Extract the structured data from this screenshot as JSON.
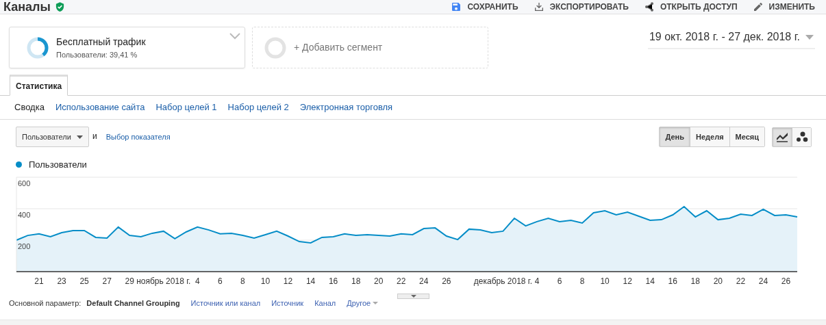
{
  "header": {
    "title": "Каналы",
    "actions": [
      {
        "label": "СОХРАНИТЬ"
      },
      {
        "label": "ЭКСПОРТИРОВАТЬ"
      },
      {
        "label": "ОТКРЫТЬ ДОСТУП"
      },
      {
        "label": "ИЗМЕНИТЬ"
      }
    ]
  },
  "segments": [
    {
      "kind": "segment",
      "name": "Бесплатный трафик",
      "subtitle": "Пользователи: 39,41 %"
    },
    {
      "kind": "add",
      "name": "+ Добавить сегмент"
    }
  ],
  "date_range": "19 окт. 2018 г. - 27 дек. 2018 г.",
  "tabs": [
    {
      "label": "Статистика",
      "selected": true
    }
  ],
  "subnav": [
    {
      "label": "Сводка",
      "selected": true
    },
    {
      "label": "Использование сайта",
      "selected": false
    },
    {
      "label": "Набор целей 1",
      "selected": false
    },
    {
      "label": "Набор целей 2",
      "selected": false
    },
    {
      "label": "Электронная торговля",
      "selected": false
    }
  ],
  "metric_select": {
    "value": "Пользователи"
  },
  "conjunction": "и",
  "metric_link": "Выбор показателя",
  "period_buttons": [
    {
      "label": "День",
      "selected": true
    },
    {
      "label": "Неделя",
      "selected": false
    },
    {
      "label": "Месяц",
      "selected": false
    }
  ],
  "chart_types": [
    {
      "selected": true
    },
    {
      "selected": false
    }
  ],
  "chart_data": {
    "type": "area",
    "categories": [
      null,
      null,
      "21",
      null,
      "23",
      null,
      "25",
      null,
      "27",
      null,
      "29",
      null,
      null,
      "ноябрь 2018 г.",
      null,
      null,
      "4",
      null,
      "6",
      null,
      "8",
      null,
      "10",
      null,
      "12",
      null,
      "14",
      null,
      "16",
      null,
      "18",
      null,
      "20",
      null,
      "22",
      null,
      "24",
      null,
      "26",
      null,
      null,
      null,
      null,
      "декабрь 2018 г.",
      null,
      null,
      "4",
      null,
      "6",
      null,
      "8",
      null,
      "10",
      null,
      "12",
      null,
      "14",
      null,
      "16",
      null,
      "18",
      null,
      "20",
      null,
      "22",
      null,
      "24",
      null,
      "26",
      null
    ],
    "series": [
      {
        "name": "Пользователи",
        "color": "#058dc7",
        "values": [
          200,
          230,
          240,
          222,
          248,
          261,
          261,
          218,
          213,
          283,
          230,
          222,
          244,
          257,
          209,
          252,
          283,
          265,
          240,
          244,
          230,
          213,
          235,
          257,
          226,
          191,
          183,
          218,
          222,
          240,
          230,
          235,
          230,
          226,
          240,
          235,
          274,
          278,
          226,
          204,
          270,
          265,
          248,
          257,
          339,
          291,
          318,
          339,
          318,
          326,
          309,
          374,
          387,
          361,
          378,
          352,
          326,
          330,
          361,
          413,
          348,
          387,
          330,
          339,
          365,
          357,
          396,
          357,
          361,
          348
        ]
      }
    ],
    "ylim": [
      0,
      600
    ],
    "yticks": [
      200,
      400,
      600
    ]
  },
  "dimensions": {
    "label": "Основной параметр:",
    "options": [
      {
        "label": "Default Channel Grouping",
        "selected": true
      },
      {
        "label": "Источник или канал",
        "selected": false
      },
      {
        "label": "Источник",
        "selected": false
      },
      {
        "label": "Канал",
        "selected": false
      }
    ],
    "more": "Другое"
  }
}
